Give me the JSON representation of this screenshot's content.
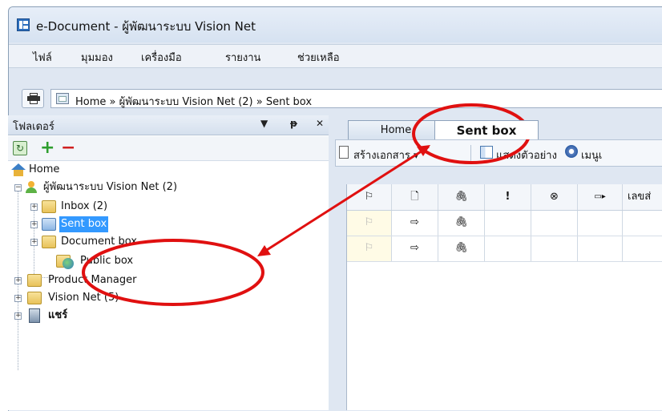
{
  "window": {
    "title": "e-Document - ผู้พัฒนาระบบ Vision Net"
  },
  "menu": [
    "ไฟล์",
    "มุมมอง",
    "เครื่องมือ",
    "รายงาน",
    "ช่วยเหลือ"
  ],
  "breadcrumb": {
    "text": "Home » ผู้พัฒนาระบบ Vision Net (2) » Sent box"
  },
  "folder_pane": {
    "title": "โฟลเดอร์",
    "controls": {
      "dropdown": "▼",
      "pin": "ᵽ",
      "close": "✕"
    },
    "tree": {
      "home": "Home",
      "dev": "ผู้พัฒนาระบบ Vision Net (2)",
      "inbox": "Inbox (2)",
      "sentbox": "Sent box",
      "document": "Document box",
      "public": "Public box",
      "product": "Product Manager",
      "visionnet": "Vision Net (5)",
      "share": "แชร์"
    }
  },
  "tabs": {
    "home": "Home",
    "sent": "Sent box"
  },
  "doc_toolbar": {
    "create": "สร้างเอกสาร ▾",
    "preview": "แสดงตัวอย่าง",
    "menu": "เมนูเ"
  },
  "grid": {
    "headers": [
      "⚐",
      "🗋",
      "🖇",
      "!",
      "⊗",
      "▭▸",
      "เลขส่"
    ],
    "rows": [
      {
        "flag": "⚐",
        "doc": "⇨",
        "attach": "🖇"
      },
      {
        "flag": "⚐",
        "doc": "⇨",
        "attach": "🖇"
      }
    ]
  },
  "accent_colors": {
    "annotation": "#e01010",
    "selection": "#3399ff"
  }
}
